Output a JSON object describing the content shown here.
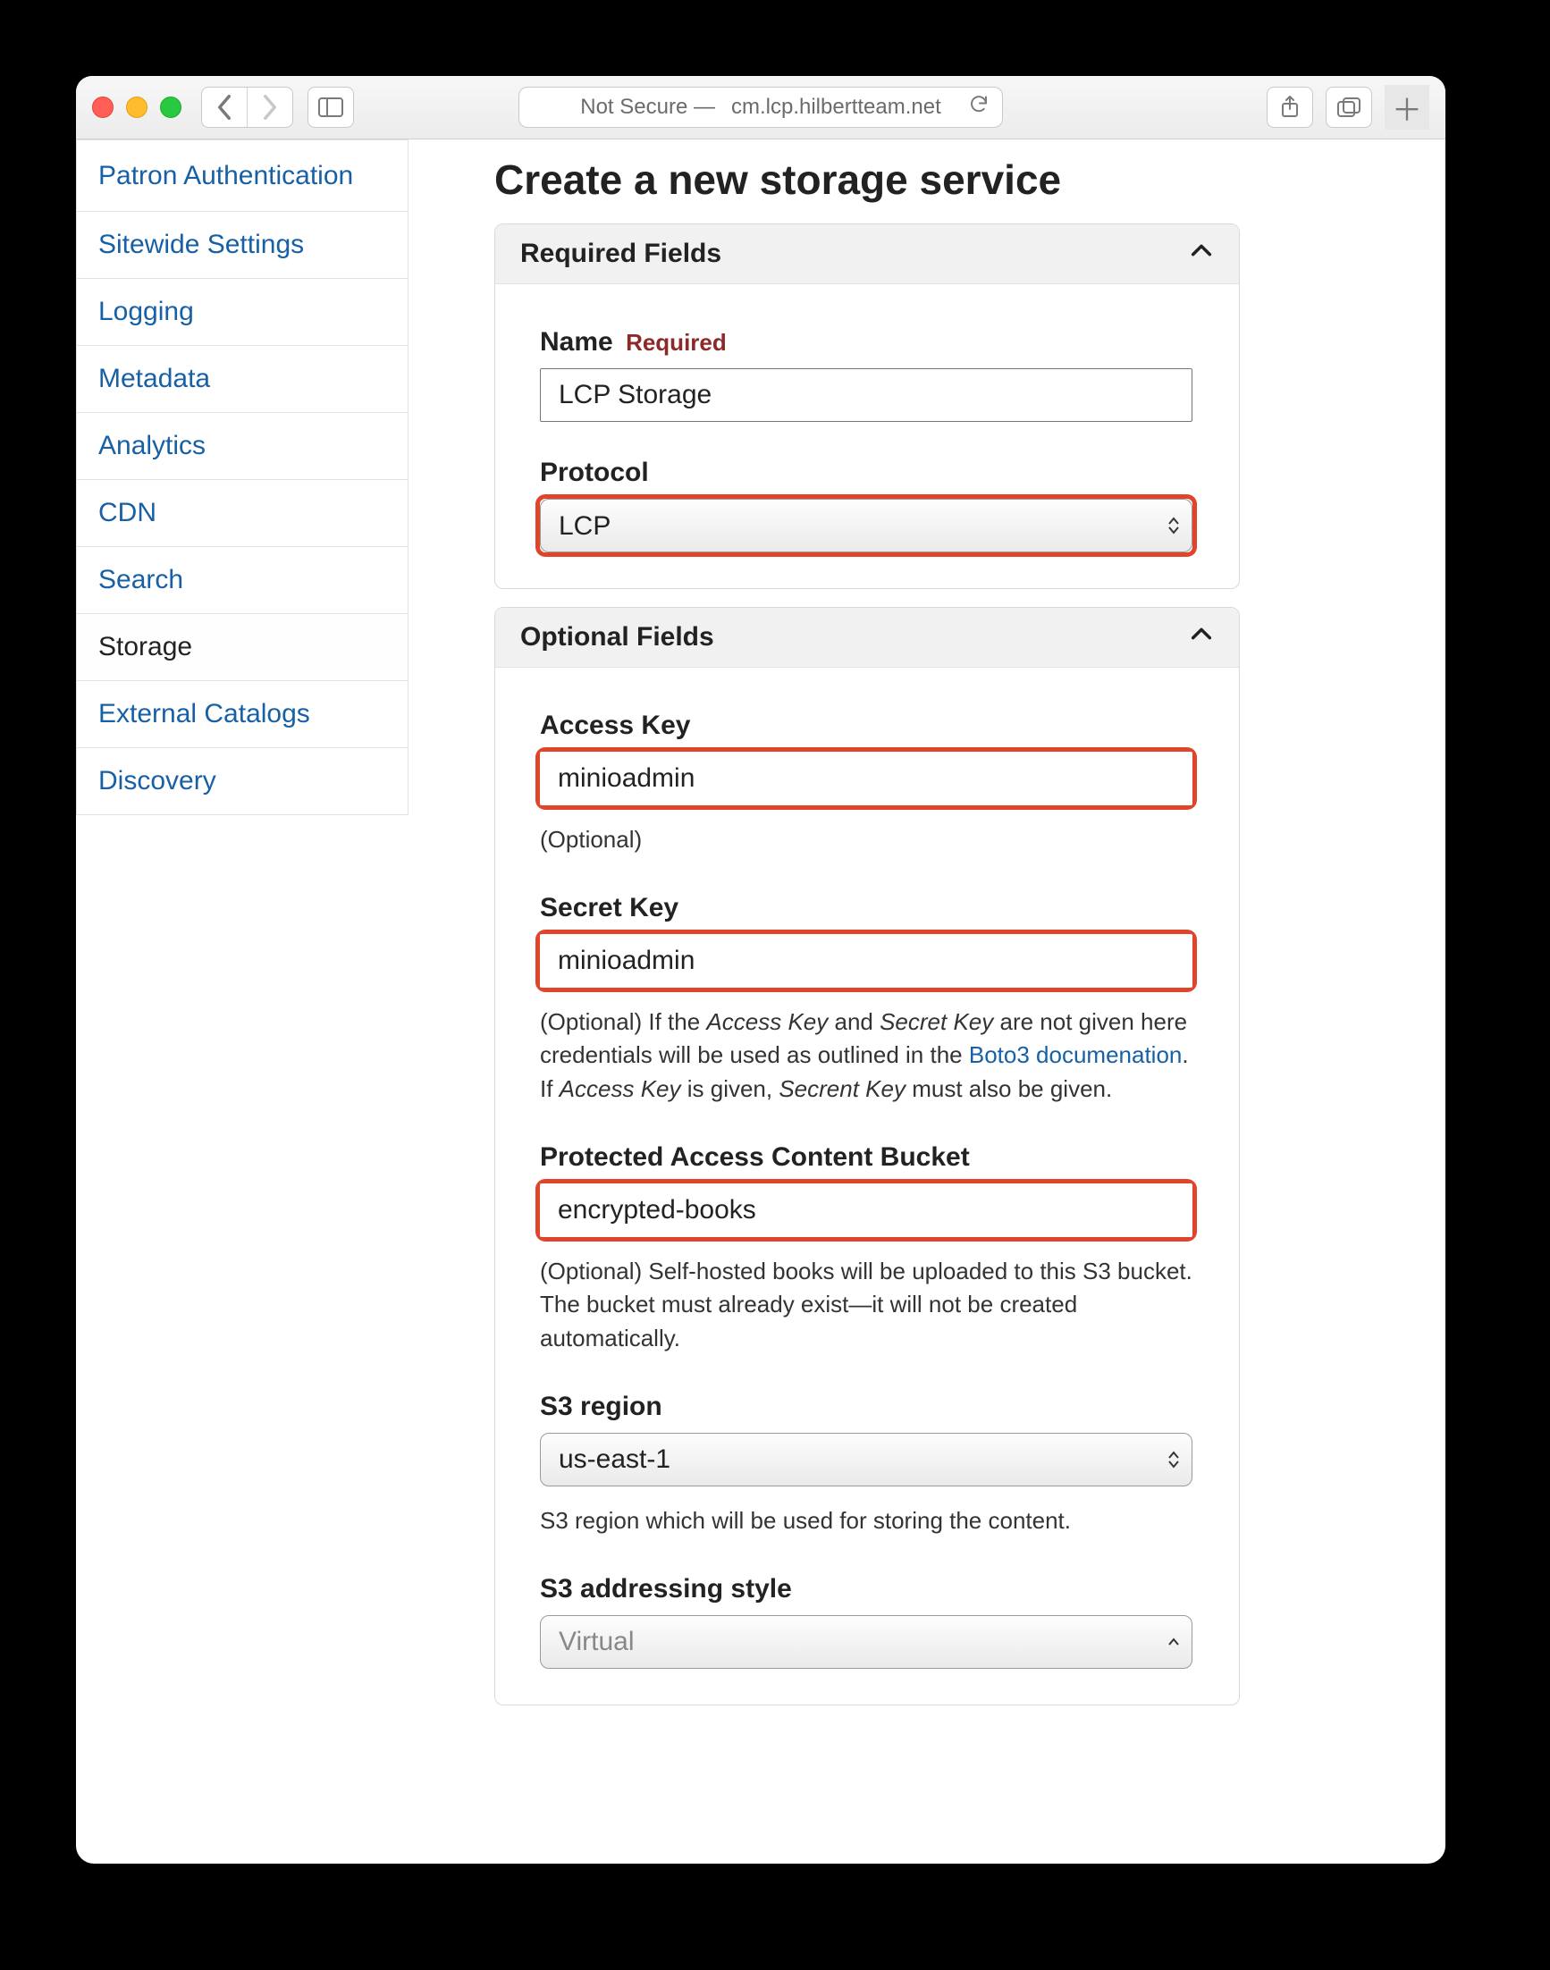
{
  "browser": {
    "security": "Not Secure —",
    "url": "cm.lcp.hilbertteam.net"
  },
  "sidebar": {
    "items": [
      {
        "label": "Patron Authentication"
      },
      {
        "label": "Sitewide Settings"
      },
      {
        "label": "Logging"
      },
      {
        "label": "Metadata"
      },
      {
        "label": "Analytics"
      },
      {
        "label": "CDN"
      },
      {
        "label": "Search"
      },
      {
        "label": "Storage",
        "active": true
      },
      {
        "label": "External Catalogs"
      },
      {
        "label": "Discovery"
      }
    ]
  },
  "main": {
    "title": "Create a new storage service",
    "required": {
      "header": "Required Fields",
      "name": {
        "label": "Name",
        "required_tag": "Required",
        "value": "LCP Storage"
      },
      "protocol": {
        "label": "Protocol",
        "value": "LCP"
      }
    },
    "optional": {
      "header": "Optional Fields",
      "access_key": {
        "label": "Access Key",
        "value": "minioadmin",
        "hint": "(Optional)"
      },
      "secret_key": {
        "label": "Secret Key",
        "value": "minioadmin",
        "hint_pre": "(Optional) If the ",
        "hint_em1": "Access Key",
        "hint_mid1": " and ",
        "hint_em2": "Secret Key",
        "hint_mid2": " are not given here credentials will be used as outlined in the ",
        "hint_link": "Boto3 documenation",
        "hint_mid3": " If ",
        "hint_em3": "Access Key",
        "hint_mid4": " is given, ",
        "hint_em4": "Secrent Key",
        "hint_post": " must also be given."
      },
      "bucket": {
        "label": "Protected Access Content Bucket",
        "value": "encrypted-books",
        "hint_line1": "(Optional) Self-hosted books will be uploaded to this S3 bucket.",
        "hint_line2": "The bucket must already exist—it will not be created automatically."
      },
      "s3_region": {
        "label": "S3 region",
        "value": "us-east-1",
        "hint": "S3 region which will be used for storing the content."
      },
      "s3_addressing": {
        "label": "S3 addressing style",
        "value": "Virtual"
      }
    }
  }
}
